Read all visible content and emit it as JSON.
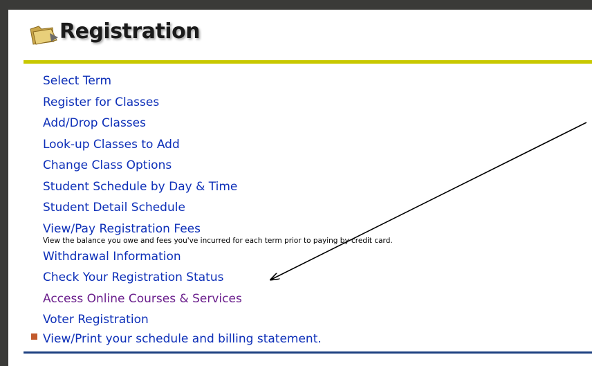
{
  "header": {
    "title": "Registration",
    "icon": "folder-icon"
  },
  "menu": {
    "items": [
      {
        "label": "Select Term"
      },
      {
        "label": "Register for Classes"
      },
      {
        "label": "Add/Drop Classes"
      },
      {
        "label": "Look-up Classes to Add"
      },
      {
        "label": "Change Class Options"
      },
      {
        "label": "Student Schedule by Day & Time"
      },
      {
        "label": "Student Detail Schedule"
      },
      {
        "label": "View/Pay Registration Fees",
        "description": "View the balance you owe and fees you've incurred for each term prior to paying by credit card."
      },
      {
        "label": "Withdrawal Information"
      },
      {
        "label": "Check Your Registration Status"
      },
      {
        "label": "Access Online Courses & Services"
      },
      {
        "label": "Voter Registration"
      }
    ]
  },
  "bullet_link": {
    "label": "View/Print your schedule and billing statement.",
    "icon": "square-bullet-icon"
  },
  "colors": {
    "link": "#0d2fb8",
    "visited_link": "#6a1e8c",
    "header_rule": "#c8c800",
    "footer_rule": "#1c3f80",
    "bullet": "#c25a2c"
  },
  "annotation": {
    "type": "arrow",
    "points_to": "Check Your Registration Status"
  }
}
